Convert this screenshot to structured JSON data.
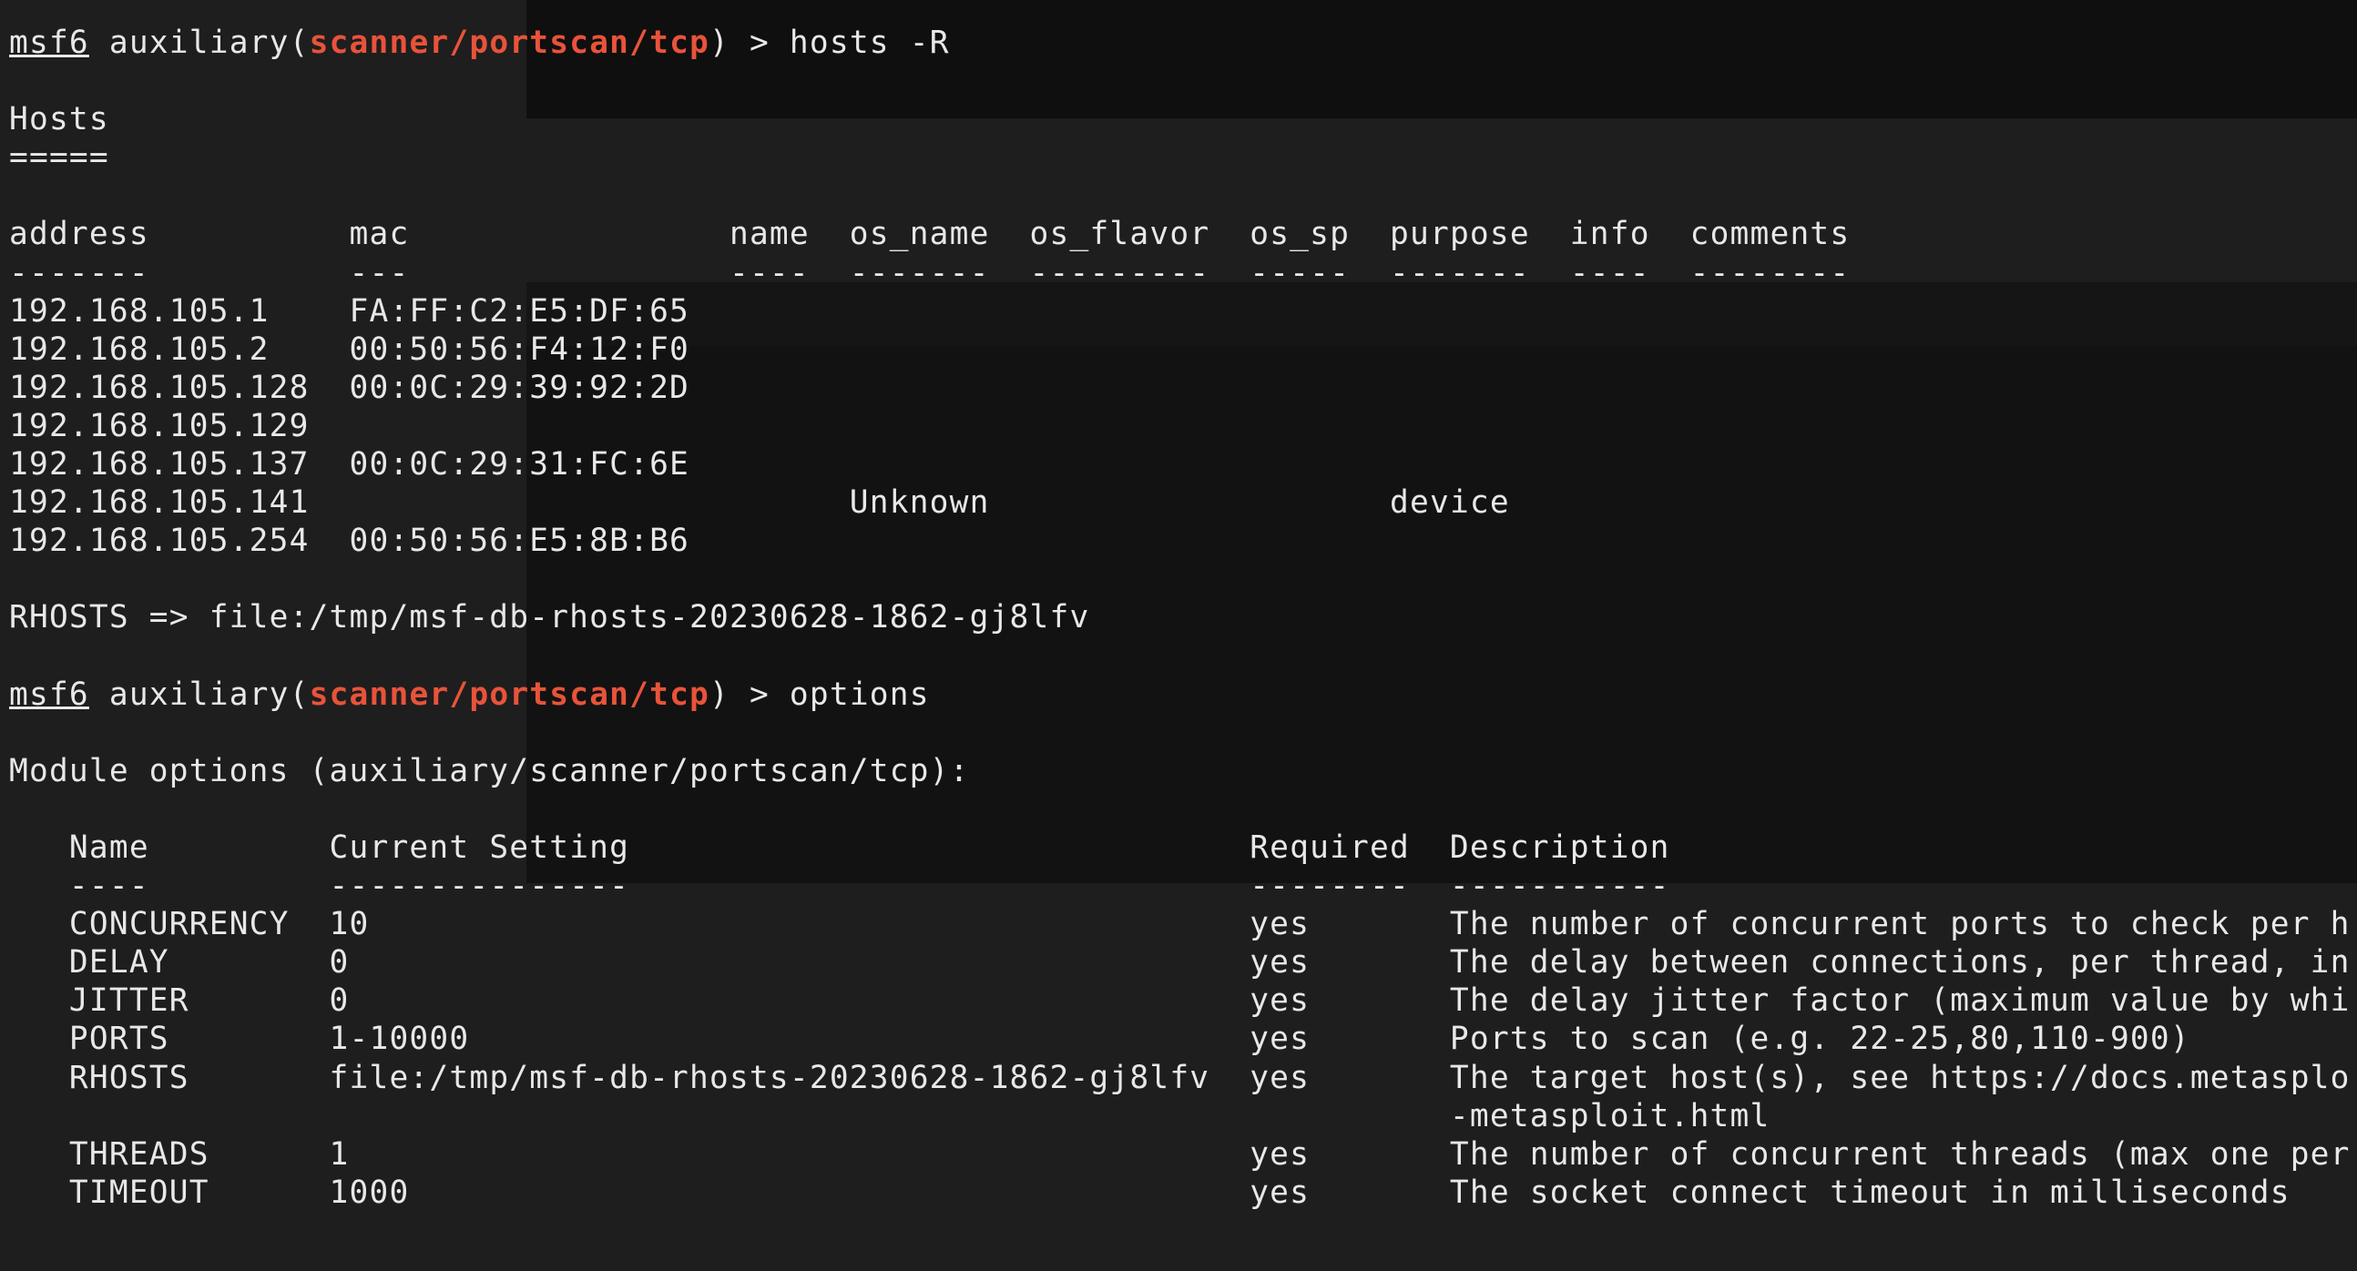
{
  "prompt": {
    "app": "msf6",
    "context": "auxiliary",
    "module": "scanner/portscan/tcp"
  },
  "commands": [
    "hosts -R",
    "options"
  ],
  "hosts": {
    "title": "Hosts",
    "underline": "=====",
    "columns": [
      "address",
      "mac",
      "name",
      "os_name",
      "os_flavor",
      "os_sp",
      "purpose",
      "info",
      "comments"
    ],
    "column_underlines": [
      "-------",
      "---",
      "----",
      "-------",
      "---------",
      "-----",
      "-------",
      "----",
      "--------"
    ],
    "rows": [
      [
        "192.168.105.1",
        "FA:FF:C2:E5:DF:65",
        "",
        "",
        "",
        "",
        "",
        "",
        ""
      ],
      [
        "192.168.105.2",
        "00:50:56:F4:12:F0",
        "",
        "",
        "",
        "",
        "",
        "",
        ""
      ],
      [
        "192.168.105.128",
        "00:0C:29:39:92:2D",
        "",
        "",
        "",
        "",
        "",
        "",
        ""
      ],
      [
        "192.168.105.129",
        "",
        "",
        "",
        "",
        "",
        "",
        "",
        ""
      ],
      [
        "192.168.105.137",
        "00:0C:29:31:FC:6E",
        "",
        "",
        "",
        "",
        "",
        "",
        ""
      ],
      [
        "192.168.105.141",
        "",
        "",
        "Unknown",
        "",
        "",
        "device",
        "",
        ""
      ],
      [
        "192.168.105.254",
        "00:50:56:E5:8B:B6",
        "",
        "",
        "",
        "",
        "",
        "",
        ""
      ]
    ]
  },
  "rhosts_line": "RHOSTS => file:/tmp/msf-db-rhosts-20230628-1862-gj8lfv",
  "module_options": {
    "title": "Module options (auxiliary/scanner/portscan/tcp):",
    "columns": [
      "Name",
      "Current Setting",
      "Required",
      "Description"
    ],
    "column_underlines": [
      "----",
      "---------------",
      "--------",
      "-----------"
    ],
    "rows": [
      [
        "CONCURRENCY",
        "10",
        "yes",
        "The number of concurrent ports to check per h"
      ],
      [
        "DELAY",
        "0",
        "yes",
        "The delay between connections, per thread, in"
      ],
      [
        "JITTER",
        "0",
        "yes",
        "The delay jitter factor (maximum value by whi"
      ],
      [
        "PORTS",
        "1-10000",
        "yes",
        "Ports to scan (e.g. 22-25,80,110-900)"
      ],
      [
        "RHOSTS",
        "file:/tmp/msf-db-rhosts-20230628-1862-gj8lfv",
        "yes",
        "The target host(s), see https://docs.metasplo"
      ],
      [
        "",
        "",
        "",
        "-metasploit.html"
      ],
      [
        "THREADS",
        "1",
        "yes",
        "The number of concurrent threads (max one per"
      ],
      [
        "TIMEOUT",
        "1000",
        "yes",
        "The socket connect timeout in milliseconds"
      ]
    ]
  },
  "colors": {
    "background": "#1e1e1e",
    "text": "#e8e8e8",
    "module": "#e8533a"
  }
}
